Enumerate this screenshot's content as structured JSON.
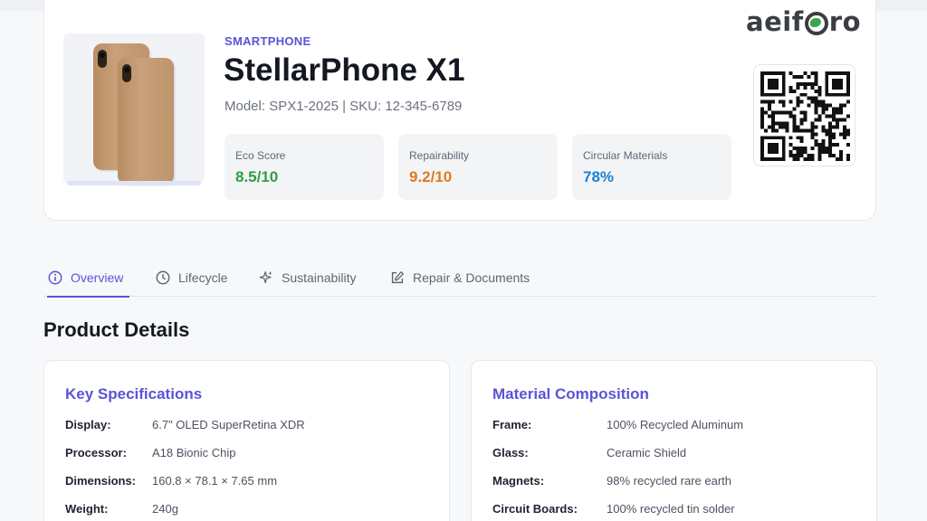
{
  "brand": {
    "logo_text_left": "aeif",
    "logo_text_right": "ro"
  },
  "product": {
    "category": "SMARTPHONE",
    "name": "StellarPhone X1",
    "model_line": "Model: SPX1-2025 | SKU: 12-345-6789"
  },
  "metrics": [
    {
      "label": "Eco Score",
      "value": "8.5/10",
      "color": "#2f9e44"
    },
    {
      "label": "Repairability",
      "value": "9.2/10",
      "color": "#e07a1f"
    },
    {
      "label": "Circular Materials",
      "value": "78%",
      "color": "#1c7ed6"
    }
  ],
  "tabs": [
    {
      "label": "Overview",
      "icon": "info-circle-icon",
      "active": true
    },
    {
      "label": "Lifecycle",
      "icon": "clock-icon",
      "active": false
    },
    {
      "label": "Sustainability",
      "icon": "sparkles-icon",
      "active": false
    },
    {
      "label": "Repair & Documents",
      "icon": "edit-document-icon",
      "active": false
    }
  ],
  "section": {
    "title": "Product Details"
  },
  "specs": {
    "title": "Key Specifications",
    "rows": [
      {
        "label": "Display:",
        "value": "6.7\" OLED SuperRetina XDR"
      },
      {
        "label": "Processor:",
        "value": "A18 Bionic Chip"
      },
      {
        "label": "Dimensions:",
        "value": "160.8 × 78.1 × 7.65 mm"
      },
      {
        "label": "Weight:",
        "value": "240g"
      }
    ]
  },
  "materials": {
    "title": "Material Composition",
    "rows": [
      {
        "label": "Frame:",
        "value": "100% Recycled Aluminum"
      },
      {
        "label": "Glass:",
        "value": "Ceramic Shield"
      },
      {
        "label": "Magnets:",
        "value": "98% recycled rare earth"
      },
      {
        "label": "Circuit Boards:",
        "value": "100% recycled tin solder"
      }
    ]
  },
  "colors": {
    "accent": "#5a54d6"
  }
}
